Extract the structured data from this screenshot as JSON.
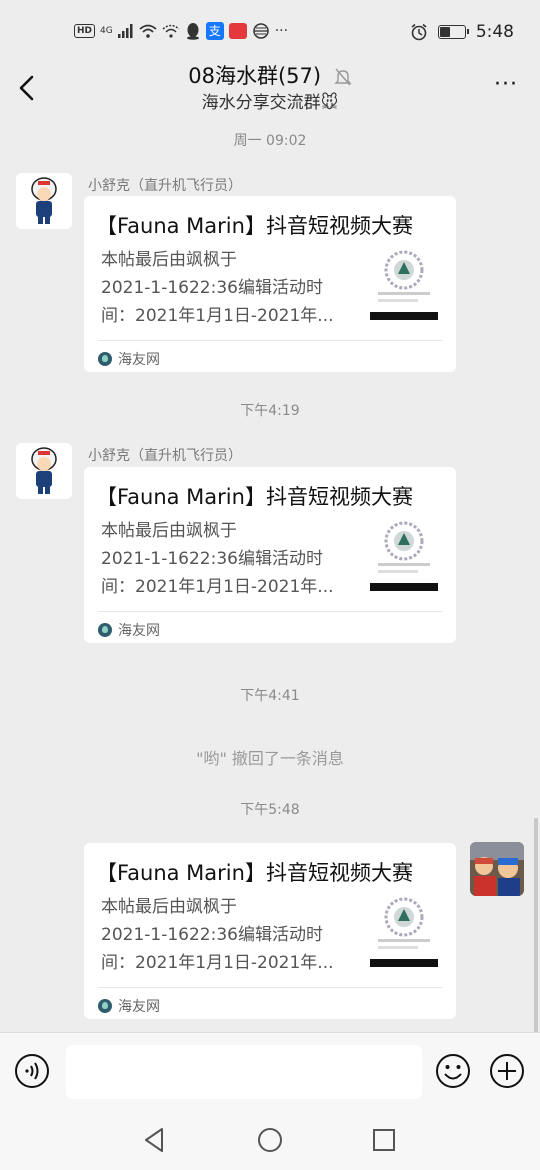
{
  "status_bar": {
    "network": "4G",
    "hd": "HD",
    "overflow": "···",
    "time": "5:48",
    "battery_level": 0.4,
    "icons": [
      "hd-icon",
      "signal-icon",
      "wifi-icon",
      "wifi-alt-icon",
      "qq-icon",
      "alipay-icon",
      "app-badge-icon",
      "news-icon",
      "alarm-icon",
      "battery-icon"
    ]
  },
  "nav": {
    "title": "08海水群(57)",
    "subtitle": "海水分享交流群🐭",
    "more": "···",
    "icons": [
      "back-arrow-icon",
      "mute-bell-icon"
    ]
  },
  "messages": [
    {
      "timestamp": "周一 09:02",
      "sender": "小舒克（直升机飞行员）",
      "card": {
        "title": "【Fauna Marin】抖音短视频大赛",
        "desc_lines": [
          "本帖最后由飒枫于",
          "2021-1-1622:36编辑活动时",
          "间：2021年1月1日-2021年..."
        ],
        "source": "海友网"
      }
    },
    {
      "timestamp": "下午4:19",
      "sender": "小舒克（直升机飞行员）",
      "card": {
        "title": "【Fauna Marin】抖音短视频大赛",
        "desc_lines": [
          "本帖最后由飒枫于",
          "2021-1-1622:36编辑活动时",
          "间：2021年1月1日-2021年..."
        ],
        "source": "海友网"
      }
    },
    {
      "timestamp": "下午4:41",
      "recall": "\"哟\" 撤回了一条消息"
    },
    {
      "timestamp": "下午5:48",
      "card": {
        "title": "【Fauna Marin】抖音短视频大赛",
        "desc_lines": [
          "本帖最后由飒枫于",
          "2021-1-1622:36编辑活动时",
          "间：2021年1月1日-2021年..."
        ],
        "source": "海友网"
      }
    }
  ],
  "input_bar": {
    "placeholder": "",
    "icons": [
      "voice-icon",
      "emoji-icon",
      "plus-icon"
    ]
  },
  "system_nav": {
    "icons": [
      "back-triangle-icon",
      "home-circle-icon",
      "recents-square-icon"
    ]
  },
  "colors": {
    "background": "#ededed",
    "card": "#ffffff",
    "timestamp": "#8a8a8a"
  }
}
